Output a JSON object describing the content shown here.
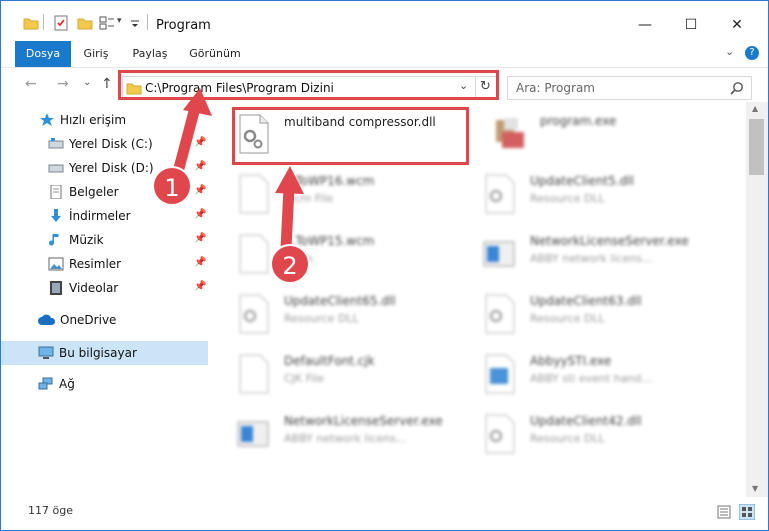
{
  "window": {
    "title": "Program"
  },
  "window_controls": {
    "minimize": "—",
    "maximize": "☐",
    "close": "✕"
  },
  "ribbon": {
    "tabs": [
      "Dosya",
      "Giriş",
      "Paylaş",
      "Görünüm"
    ],
    "collapse": "⌄",
    "help": "?"
  },
  "nav": {
    "back": "←",
    "forward": "→",
    "recent": "⌄",
    "up": "↑",
    "address": "C:\\Program Files\\Program Dizini",
    "address_dropdown": "⌄",
    "refresh": "↻",
    "search_placeholder": "Ara: Program"
  },
  "sidebar": {
    "items": [
      {
        "label": "Hızlı erişim",
        "icon": "star-icon",
        "pinned": false
      },
      {
        "label": "Yerel Disk (C:)",
        "icon": "drive-icon",
        "pinned": true
      },
      {
        "label": "Yerel Disk (D:)",
        "icon": "drive-icon",
        "pinned": true
      },
      {
        "label": "Belgeler",
        "icon": "document-icon",
        "pinned": true
      },
      {
        "label": "İndirmeler",
        "icon": "download-icon",
        "pinned": true
      },
      {
        "label": "Müzik",
        "icon": "music-icon",
        "pinned": true
      },
      {
        "label": "Resimler",
        "icon": "picture-icon",
        "pinned": true
      },
      {
        "label": "Videolar",
        "icon": "video-icon",
        "pinned": true
      },
      {
        "label": "OneDrive",
        "icon": "cloud-icon",
        "pinned": false
      },
      {
        "label": "Bu bilgisayar",
        "icon": "computer-icon",
        "pinned": false,
        "selected": true
      },
      {
        "label": "Ağ",
        "icon": "network-icon",
        "pinned": false
      }
    ]
  },
  "files": [
    {
      "name": "multiband compressor.dll",
      "sub": "",
      "type": "dll",
      "highlighted": true
    },
    {
      "name": "program.exe",
      "sub": "",
      "type": "exe"
    },
    {
      "name": "...ToWP16.wcm",
      "sub": "...cm File",
      "type": "doc"
    },
    {
      "name": "UpdateClient5.dll",
      "sub": "Resource DLL",
      "type": "dll"
    },
    {
      "name": "...ToWP15.wcm",
      "sub": "...File",
      "type": "doc"
    },
    {
      "name": "NetworkLicenseServer.exe",
      "sub": "ABBY network licens...",
      "type": "app"
    },
    {
      "name": "UpdateClient65.dll",
      "sub": "Resource DLL",
      "type": "dll"
    },
    {
      "name": "UpdateClient63.dll",
      "sub": "Resource DLL",
      "type": "dll"
    },
    {
      "name": "DefaultFont.cjk",
      "sub": "CJK File",
      "type": "doc"
    },
    {
      "name": "AbbyySTI.exe",
      "sub": "ABBY sti event hand...",
      "type": "app"
    },
    {
      "name": "NetworkLicenseServer.exe",
      "sub": "ABBY network licens...",
      "type": "app"
    },
    {
      "name": "UpdateClient42.dll",
      "sub": "Resource DLL",
      "type": "dll"
    }
  ],
  "status": {
    "count": "117 öge"
  },
  "annotations": {
    "step1": "1",
    "step2": "2"
  },
  "colors": {
    "accent": "#1979ca",
    "annotation": "#e0474c",
    "selection": "#cce4f7"
  }
}
